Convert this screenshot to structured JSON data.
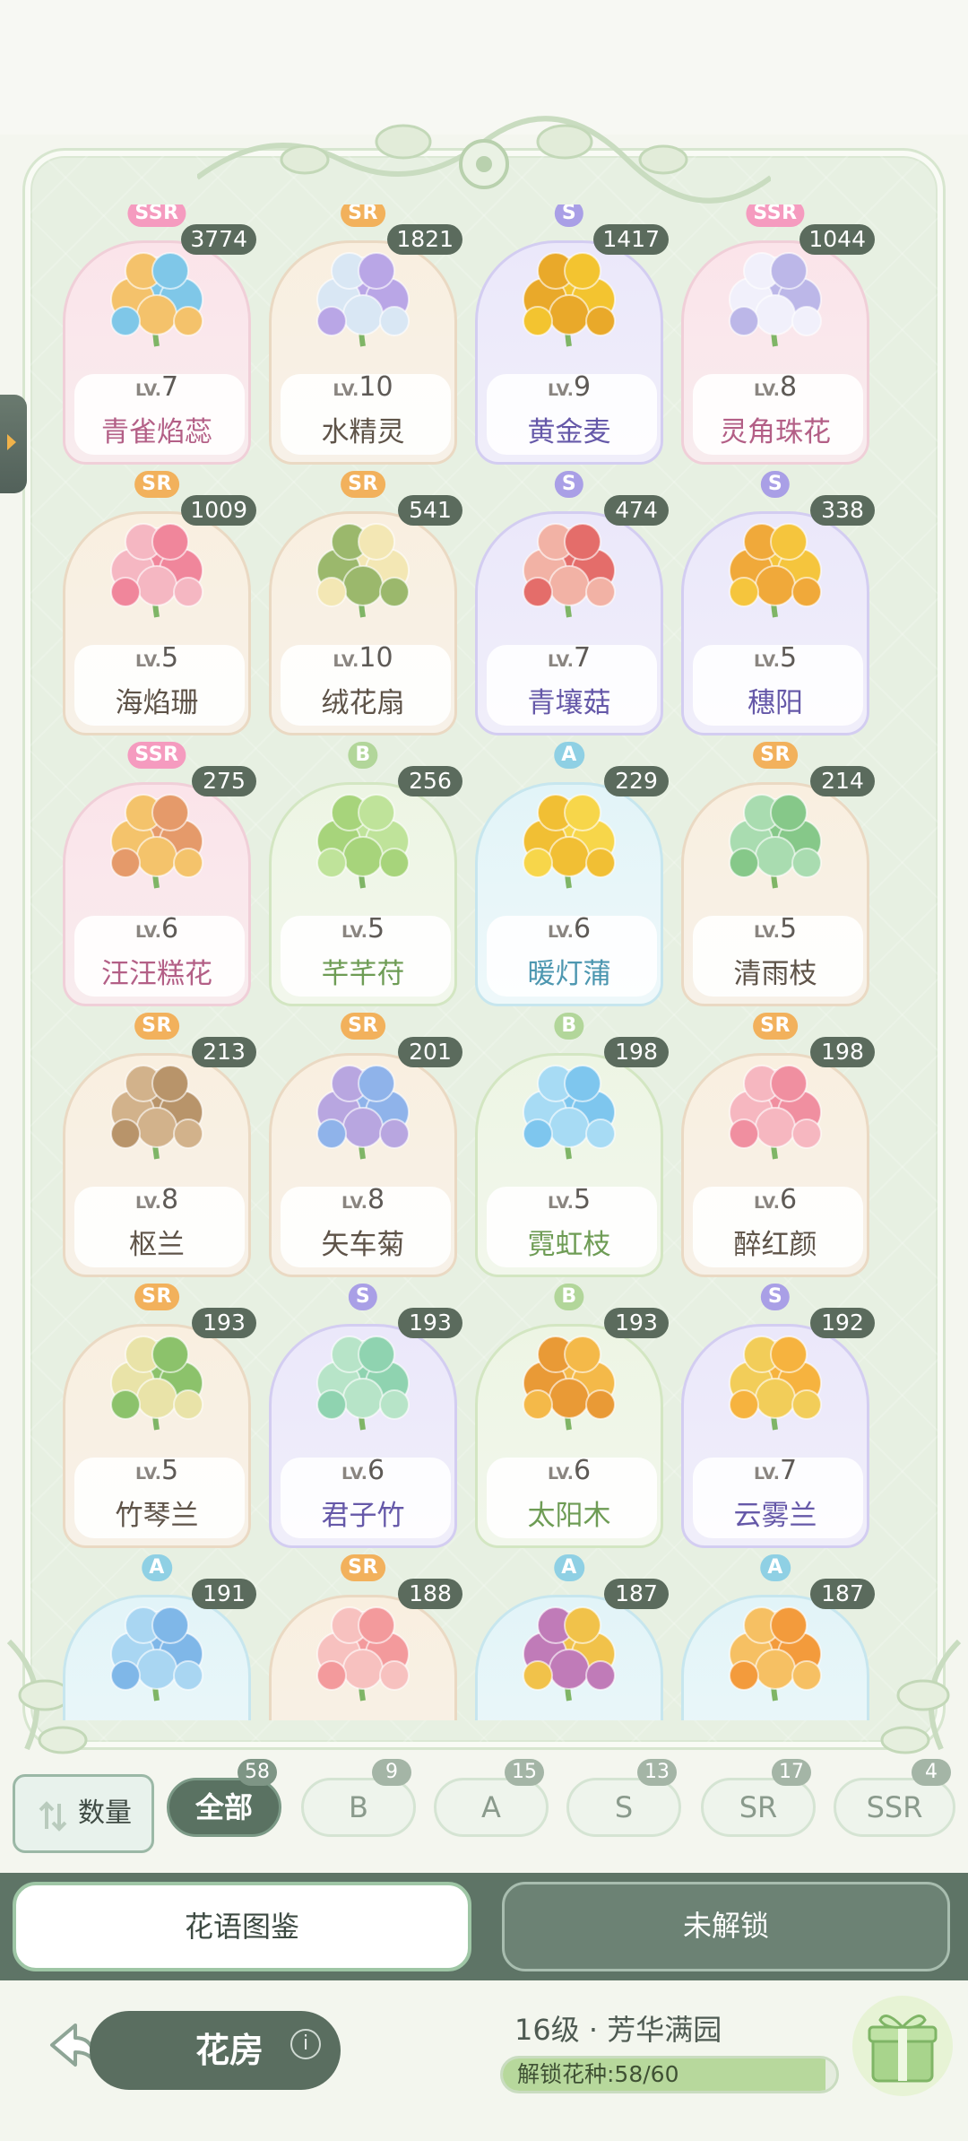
{
  "cards": [
    {
      "tier": "SSR",
      "count": "3774",
      "lv": "7",
      "name": "青雀焰蕊",
      "colors": [
        "#7fc7e8",
        "#f4c26b"
      ]
    },
    {
      "tier": "SR",
      "count": "1821",
      "lv": "10",
      "name": "水精灵",
      "colors": [
        "#b9a6e6",
        "#d9e7f4"
      ]
    },
    {
      "tier": "S",
      "count": "1417",
      "lv": "9",
      "name": "黄金麦",
      "colors": [
        "#f3c430",
        "#e9a92a"
      ]
    },
    {
      "tier": "SSR",
      "count": "1044",
      "lv": "8",
      "name": "灵角珠花",
      "colors": [
        "#bcb7e8",
        "#f1f0fb"
      ]
    },
    {
      "tier": "SR",
      "count": "1009",
      "lv": "5",
      "name": "海焰珊",
      "colors": [
        "#f0869b",
        "#f5b7c2"
      ]
    },
    {
      "tier": "SR",
      "count": "541",
      "lv": "10",
      "name": "绒花扇",
      "colors": [
        "#f3e7b4",
        "#9bb86c"
      ]
    },
    {
      "tier": "S",
      "count": "474",
      "lv": "7",
      "name": "青壤菇",
      "colors": [
        "#e46d6a",
        "#f2b2a5"
      ]
    },
    {
      "tier": "S",
      "count": "338",
      "lv": "5",
      "name": "穗阳",
      "colors": [
        "#f5c53d",
        "#f0a93a"
      ]
    },
    {
      "tier": "SSR",
      "count": "275",
      "lv": "6",
      "name": "汪汪糕花",
      "colors": [
        "#e59a6a",
        "#f4c36b"
      ]
    },
    {
      "tier": "B",
      "count": "256",
      "lv": "5",
      "name": "芊芊苻",
      "colors": [
        "#bfe39a",
        "#a7d47b"
      ]
    },
    {
      "tier": "A",
      "count": "229",
      "lv": "6",
      "name": "暖灯蒲",
      "colors": [
        "#f7d64a",
        "#f1bf34"
      ]
    },
    {
      "tier": "SR",
      "count": "214",
      "lv": "5",
      "name": "清雨枝",
      "colors": [
        "#86c889",
        "#a9dcb0"
      ]
    },
    {
      "tier": "SR",
      "count": "213",
      "lv": "8",
      "name": "枢兰",
      "colors": [
        "#b8946a",
        "#d2b28b"
      ]
    },
    {
      "tier": "SR",
      "count": "201",
      "lv": "8",
      "name": "矢车菊",
      "colors": [
        "#8fb3ea",
        "#b8a6e0"
      ]
    },
    {
      "tier": "B",
      "count": "198",
      "lv": "5",
      "name": "霓虹枝",
      "colors": [
        "#7ec6ee",
        "#a7dbf4"
      ]
    },
    {
      "tier": "SR",
      "count": "198",
      "lv": "6",
      "name": "醉红颜",
      "colors": [
        "#f08fa0",
        "#f6b7c0"
      ]
    },
    {
      "tier": "SR",
      "count": "193",
      "lv": "5",
      "name": "竹琴兰",
      "colors": [
        "#8cc26b",
        "#e9e3a8"
      ]
    },
    {
      "tier": "S",
      "count": "193",
      "lv": "6",
      "name": "君子竹",
      "colors": [
        "#8fd3b0",
        "#b7e4c8"
      ]
    },
    {
      "tier": "B",
      "count": "193",
      "lv": "6",
      "name": "太阳木",
      "colors": [
        "#f4b949",
        "#e99a36"
      ]
    },
    {
      "tier": "S",
      "count": "192",
      "lv": "7",
      "name": "云雾兰",
      "colors": [
        "#f6b33f",
        "#f2cd59"
      ]
    },
    {
      "tier": "A",
      "count": "191",
      "lv": "",
      "name": "",
      "colors": [
        "#7fb7e8",
        "#a9d6f2"
      ]
    },
    {
      "tier": "SR",
      "count": "188",
      "lv": "",
      "name": "",
      "colors": [
        "#f39a9c",
        "#f7c1bf"
      ]
    },
    {
      "tier": "A",
      "count": "187",
      "lv": "",
      "name": "",
      "colors": [
        "#f1c24a",
        "#c07bb8"
      ]
    },
    {
      "tier": "A",
      "count": "187",
      "lv": "",
      "name": "",
      "colors": [
        "#f39b3c",
        "#f6c063"
      ]
    }
  ],
  "lv_prefix": "LV.",
  "filters": {
    "sort_label": "数量",
    "chips": [
      {
        "label": "全部",
        "count": "58",
        "active": true
      },
      {
        "label": "B",
        "count": "9",
        "active": false
      },
      {
        "label": "A",
        "count": "15",
        "active": false
      },
      {
        "label": "S",
        "count": "13",
        "active": false
      },
      {
        "label": "SR",
        "count": "17",
        "active": false
      },
      {
        "label": "SSR",
        "count": "4",
        "active": false
      }
    ]
  },
  "tabs": {
    "active": "花语图鉴",
    "inactive": "未解锁"
  },
  "bottom": {
    "room": "花房",
    "info": "i",
    "level": "16级 · 芳华满园",
    "progress_label": "解锁花种:58/60",
    "progress_fraction": 0.967
  }
}
